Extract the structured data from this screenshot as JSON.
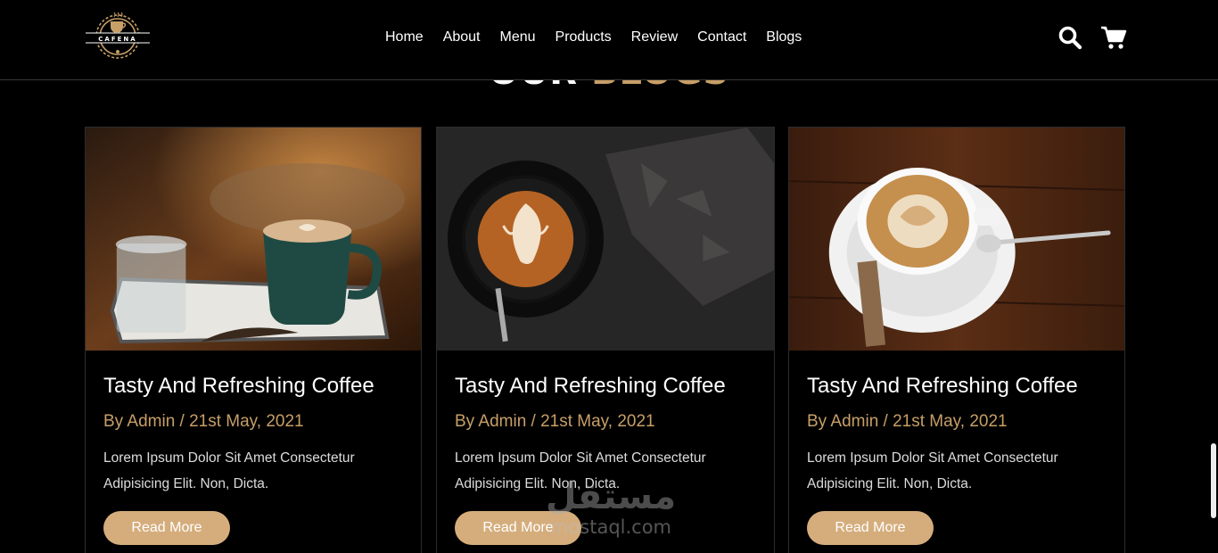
{
  "header": {
    "logo_text": "CAFENA",
    "nav": [
      "Home",
      "About",
      "Menu",
      "Products",
      "Review",
      "Contact",
      "Blogs"
    ],
    "icons": [
      "search-icon",
      "cart-icon"
    ]
  },
  "section": {
    "title_white": "OUR",
    "title_accent": "BLOGS"
  },
  "cards": [
    {
      "title": "Tasty And Refreshing Coffee",
      "meta": "By Admin / 21st May, 2021",
      "text": "Lorem Ipsum Dolor Sit Amet Consectetur Adipisicing Elit. Non, Dicta.",
      "button": "Read More"
    },
    {
      "title": "Tasty And Refreshing Coffee",
      "meta": "By Admin / 21st May, 2021",
      "text": "Lorem Ipsum Dolor Sit Amet Consectetur Adipisicing Elit. Non, Dicta.",
      "button": "Read More"
    },
    {
      "title": "Tasty And Refreshing Coffee",
      "meta": "By Admin / 21st May, 2021",
      "text": "Lorem Ipsum Dolor Sit Amet Consectetur Adipisicing Elit. Non, Dicta.",
      "button": "Read More"
    }
  ],
  "watermark": {
    "arabic": "مستقل",
    "latin": "mostaql.com"
  },
  "colors": {
    "accent": "#c79f67",
    "button": "#d5ad7c",
    "background": "#000000"
  }
}
